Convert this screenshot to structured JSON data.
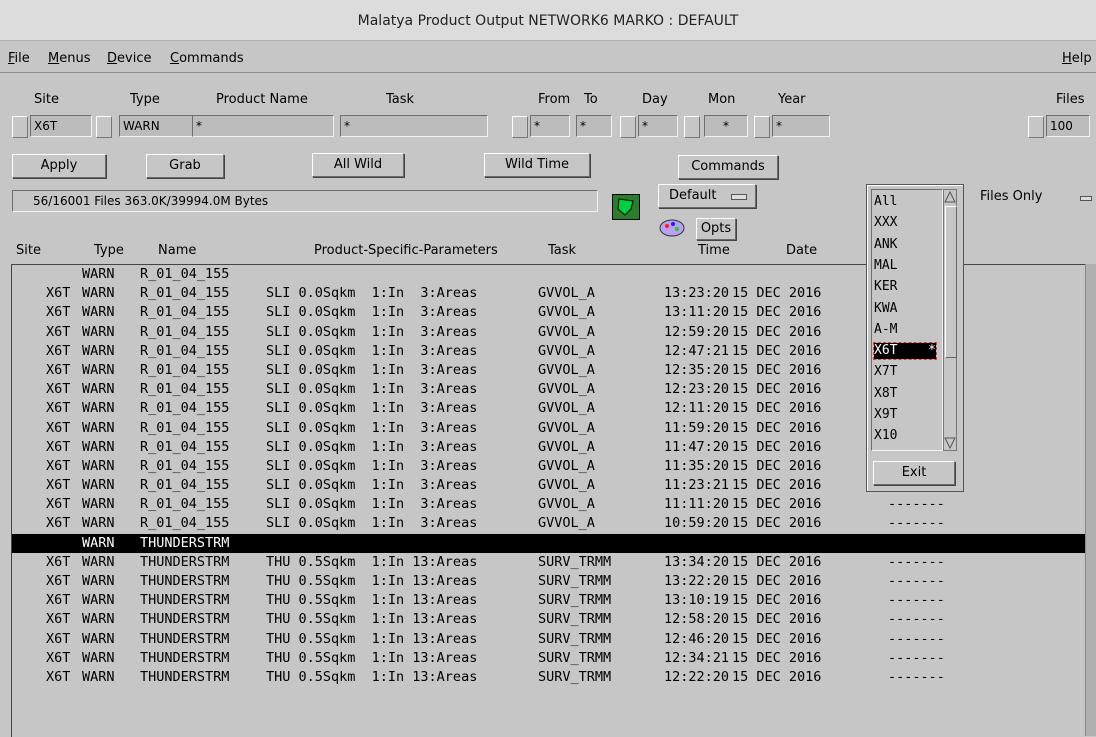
{
  "window": {
    "title": "Malatya  Product Output NETWORK6 MARKO : DEFAULT"
  },
  "menu": {
    "file": "File",
    "menus": "Menus",
    "device": "Device",
    "commands": "Commands",
    "help": "Help"
  },
  "labels": {
    "site": "Site",
    "type": "Type",
    "product_name": "Product Name",
    "task": "Task",
    "from": "From",
    "to": "To",
    "day": "Day",
    "mon": "Mon",
    "year": "Year",
    "files": "Files"
  },
  "fields": {
    "site": "X6T",
    "type": "WARN",
    "product_name": "*",
    "task": "*",
    "from": "*",
    "to": "*",
    "day": "*",
    "mon": "*",
    "year": "*",
    "files": "100"
  },
  "buttons": {
    "apply": "Apply",
    "grab": "Grab",
    "all_wild": "All Wild",
    "wild_time": "Wild Time",
    "commands": "Commands",
    "opts": "Opts",
    "exit": "Exit"
  },
  "status": {
    "files_info": "56/16001 Files   363.0K/39994.0M Bytes"
  },
  "selects": {
    "default": "Default",
    "files_only": "Files Only"
  },
  "columns": {
    "site": "Site",
    "type": "Type",
    "name": "Name",
    "params": "Product-Specific-Parameters",
    "task": "Task",
    "time": "Time",
    "date": "Date"
  },
  "site_list": [
    "All",
    "XXX",
    "ANK",
    "MAL",
    "KER",
    "KWA",
    "A-M",
    "X6T",
    "X7T",
    "X8T",
    "X9T",
    "X10"
  ],
  "site_list_selected": "X6T",
  "site_list_marker": "*",
  "rows": [
    {
      "site": "",
      "type": "WARN",
      "name": "R_01_04_155",
      "params": "",
      "task": "",
      "time": "",
      "date": "",
      "extra": ""
    },
    {
      "site": "X6T",
      "type": "WARN",
      "name": "R_01_04_155",
      "params": "SLI 0.0Sqkm  1:In  3:Areas",
      "task": "GVVOL_A",
      "time": "13:23:20",
      "date": "15 DEC 2016",
      "extra": ""
    },
    {
      "site": "X6T",
      "type": "WARN",
      "name": "R_01_04_155",
      "params": "SLI 0.0Sqkm  1:In  3:Areas",
      "task": "GVVOL_A",
      "time": "13:11:20",
      "date": "15 DEC 2016",
      "extra": ""
    },
    {
      "site": "X6T",
      "type": "WARN",
      "name": "R_01_04_155",
      "params": "SLI 0.0Sqkm  1:In  3:Areas",
      "task": "GVVOL_A",
      "time": "12:59:20",
      "date": "15 DEC 2016",
      "extra": ""
    },
    {
      "site": "X6T",
      "type": "WARN",
      "name": "R_01_04_155",
      "params": "SLI 0.0Sqkm  1:In  3:Areas",
      "task": "GVVOL_A",
      "time": "12:47:21",
      "date": "15 DEC 2016",
      "extra": ""
    },
    {
      "site": "X6T",
      "type": "WARN",
      "name": "R_01_04_155",
      "params": "SLI 0.0Sqkm  1:In  3:Areas",
      "task": "GVVOL_A",
      "time": "12:35:20",
      "date": "15 DEC 2016",
      "extra": ""
    },
    {
      "site": "X6T",
      "type": "WARN",
      "name": "R_01_04_155",
      "params": "SLI 0.0Sqkm  1:In  3:Areas",
      "task": "GVVOL_A",
      "time": "12:23:20",
      "date": "15 DEC 2016",
      "extra": ""
    },
    {
      "site": "X6T",
      "type": "WARN",
      "name": "R_01_04_155",
      "params": "SLI 0.0Sqkm  1:In  3:Areas",
      "task": "GVVOL_A",
      "time": "12:11:20",
      "date": "15 DEC 2016",
      "extra": ""
    },
    {
      "site": "X6T",
      "type": "WARN",
      "name": "R_01_04_155",
      "params": "SLI 0.0Sqkm  1:In  3:Areas",
      "task": "GVVOL_A",
      "time": "11:59:20",
      "date": "15 DEC 2016",
      "extra": ""
    },
    {
      "site": "X6T",
      "type": "WARN",
      "name": "R_01_04_155",
      "params": "SLI 0.0Sqkm  1:In  3:Areas",
      "task": "GVVOL_A",
      "time": "11:47:20",
      "date": "15 DEC 2016",
      "extra": ""
    },
    {
      "site": "X6T",
      "type": "WARN",
      "name": "R_01_04_155",
      "params": "SLI 0.0Sqkm  1:In  3:Areas",
      "task": "GVVOL_A",
      "time": "11:35:20",
      "date": "15 DEC 2016",
      "extra": "-------"
    },
    {
      "site": "X6T",
      "type": "WARN",
      "name": "R_01_04_155",
      "params": "SLI 0.0Sqkm  1:In  3:Areas",
      "task": "GVVOL_A",
      "time": "11:23:21",
      "date": "15 DEC 2016",
      "extra": "-------"
    },
    {
      "site": "X6T",
      "type": "WARN",
      "name": "R_01_04_155",
      "params": "SLI 0.0Sqkm  1:In  3:Areas",
      "task": "GVVOL_A",
      "time": "11:11:20",
      "date": "15 DEC 2016",
      "extra": "-------"
    },
    {
      "site": "X6T",
      "type": "WARN",
      "name": "R_01_04_155",
      "params": "SLI 0.0Sqkm  1:In  3:Areas",
      "task": "GVVOL_A",
      "time": "10:59:20",
      "date": "15 DEC 2016",
      "extra": "-------"
    },
    {
      "site": "",
      "type": "WARN",
      "name": "THUNDERSTRM",
      "params": "",
      "task": "",
      "time": "",
      "date": "",
      "extra": ""
    },
    {
      "site": "X6T",
      "type": "WARN",
      "name": "THUNDERSTRM",
      "params": "THU 0.5Sqkm  1:In 13:Areas",
      "task": "SURV_TRMM",
      "time": "13:34:20",
      "date": "15 DEC 2016",
      "extra": "-------"
    },
    {
      "site": "X6T",
      "type": "WARN",
      "name": "THUNDERSTRM",
      "params": "THU 0.5Sqkm  1:In 13:Areas",
      "task": "SURV_TRMM",
      "time": "13:22:20",
      "date": "15 DEC 2016",
      "extra": "-------"
    },
    {
      "site": "X6T",
      "type": "WARN",
      "name": "THUNDERSTRM",
      "params": "THU 0.5Sqkm  1:In 13:Areas",
      "task": "SURV_TRMM",
      "time": "13:10:19",
      "date": "15 DEC 2016",
      "extra": "-------"
    },
    {
      "site": "X6T",
      "type": "WARN",
      "name": "THUNDERSTRM",
      "params": "THU 0.5Sqkm  1:In 13:Areas",
      "task": "SURV_TRMM",
      "time": "12:58:20",
      "date": "15 DEC 2016",
      "extra": "-------"
    },
    {
      "site": "X6T",
      "type": "WARN",
      "name": "THUNDERSTRM",
      "params": "THU 0.5Sqkm  1:In 13:Areas",
      "task": "SURV_TRMM",
      "time": "12:46:20",
      "date": "15 DEC 2016",
      "extra": "-------"
    },
    {
      "site": "X6T",
      "type": "WARN",
      "name": "THUNDERSTRM",
      "params": "THU 0.5Sqkm  1:In 13:Areas",
      "task": "SURV_TRMM",
      "time": "12:34:21",
      "date": "15 DEC 2016",
      "extra": "-------"
    },
    {
      "site": "X6T",
      "type": "WARN",
      "name": "THUNDERSTRM",
      "params": "THU 0.5Sqkm  1:In 13:Areas",
      "task": "SURV_TRMM",
      "time": "12:22:20",
      "date": "15 DEC 2016",
      "extra": "-------"
    }
  ],
  "selected_row_index": 14
}
